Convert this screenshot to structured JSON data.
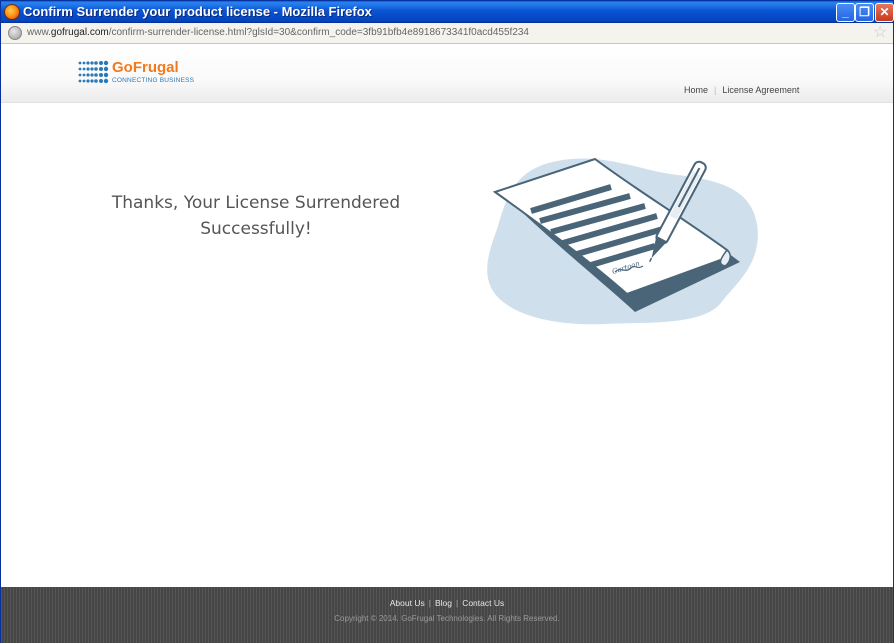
{
  "window": {
    "title": "Confirm Surrender your product license - Mozilla Firefox",
    "minimize_label": "_",
    "maximize_label": "❐",
    "close_label": "✕"
  },
  "addressbar": {
    "url_prefix": "www.",
    "url_domain": "gofrugal.com",
    "url_path": "/confirm-surrender-license.html?glsId=30&confirm_code=3fb91bfb4e8918673341f0acd455f234",
    "bookmark_icon": "star-icon"
  },
  "header": {
    "brand": "GoFrugal",
    "tagline": "CONNECTING BUSINESS",
    "nav": [
      {
        "label": "Home"
      },
      {
        "label": "License Agreement"
      }
    ]
  },
  "main": {
    "message_line1": "Thanks, Your License Surrendered",
    "message_line2": "Successfully!",
    "illustration_icon": "signed-document-pen-icon",
    "signature_text": "Cartoon"
  },
  "footer": {
    "links": [
      {
        "label": "About Us"
      },
      {
        "label": "Blog"
      },
      {
        "label": "Contact Us"
      }
    ],
    "copyright": "Copyright © 2014. GoFrugal Technologies. All Rights Reserved."
  },
  "colors": {
    "brand_orange": "#f27a1c",
    "brand_blue": "#2a78b6",
    "titlebar_blue": "#0b55d4",
    "footer_gray": "#4b4b4b",
    "illustration_bg": "#cfe0ec",
    "illustration_ink": "#4a6478"
  }
}
